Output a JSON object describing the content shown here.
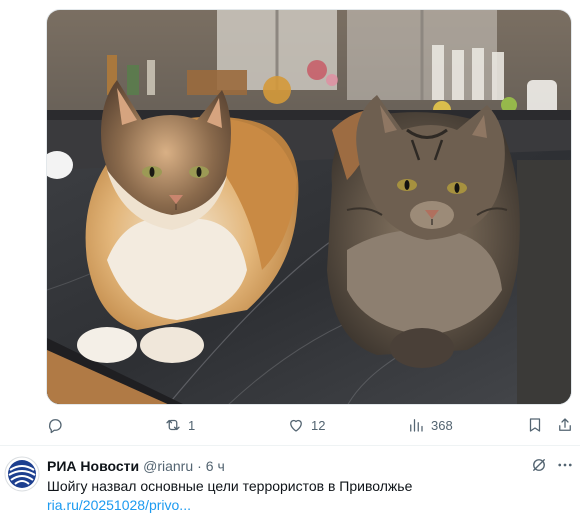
{
  "media": {
    "description_alt": ""
  },
  "actions": {
    "reply_count": "",
    "repost_count": "1",
    "like_count": "12",
    "views_count": "368"
  },
  "next_tweet": {
    "author_name": "РИА Новости",
    "handle": "@rianru",
    "separator": "·",
    "time": "6 ч",
    "text": "Шойгу назвал основные цели террористов в Приволжье",
    "link": "ria.ru/20251028/privo..."
  },
  "colors": {
    "muted": "#536471",
    "link": "#1d9bf0",
    "avatar_brand": "#1d3f8f"
  }
}
